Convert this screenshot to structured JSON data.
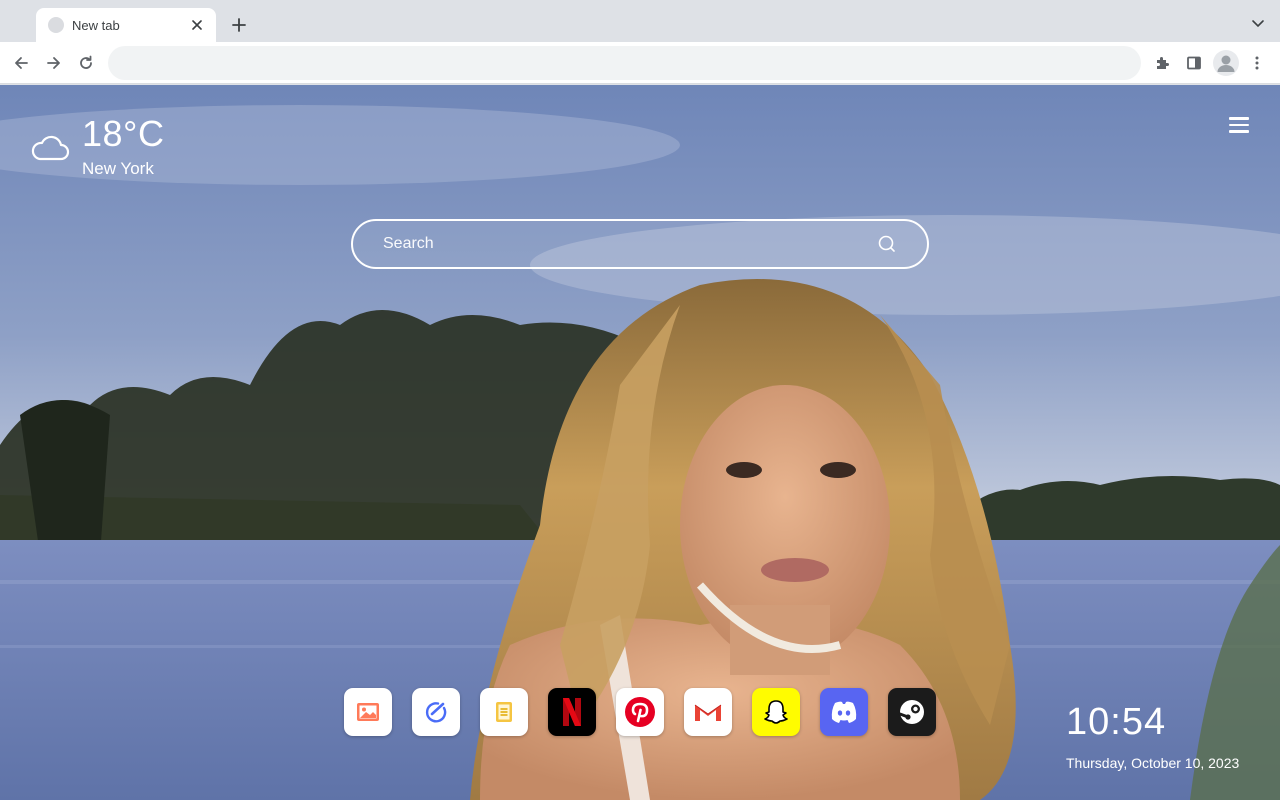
{
  "browser": {
    "tab": {
      "title": "New tab"
    },
    "omnibox": {
      "value": ""
    }
  },
  "weather": {
    "temperature": "18°C",
    "city": "New York",
    "icon": "cloud-icon"
  },
  "search": {
    "placeholder": "Search"
  },
  "shortcuts": [
    {
      "name": "photos",
      "icon": "photo-icon",
      "bg": "#ffffff"
    },
    {
      "name": "tasks",
      "icon": "check-pen-icon",
      "bg": "#ffffff"
    },
    {
      "name": "notes",
      "icon": "notes-icon",
      "bg": "#ffffff"
    },
    {
      "name": "netflix",
      "icon": "netflix-icon",
      "bg": "#000000"
    },
    {
      "name": "pinterest",
      "icon": "pinterest-icon",
      "bg": "#ffffff"
    },
    {
      "name": "gmail",
      "icon": "gmail-icon",
      "bg": "#ffffff"
    },
    {
      "name": "snapchat",
      "icon": "snapchat-icon",
      "bg": "#fffc00"
    },
    {
      "name": "discord",
      "icon": "discord-icon",
      "bg": "#5865f2"
    },
    {
      "name": "steam",
      "icon": "steam-icon",
      "bg": "#1b1b1b"
    }
  ],
  "clock": {
    "time": "10:54",
    "date": "Thursday, October 10, 2023"
  },
  "colors": {
    "netflix_red": "#e50914",
    "pinterest_red": "#e60023",
    "discord_blurple": "#5865f2",
    "snapchat_yellow": "#fffc00"
  }
}
